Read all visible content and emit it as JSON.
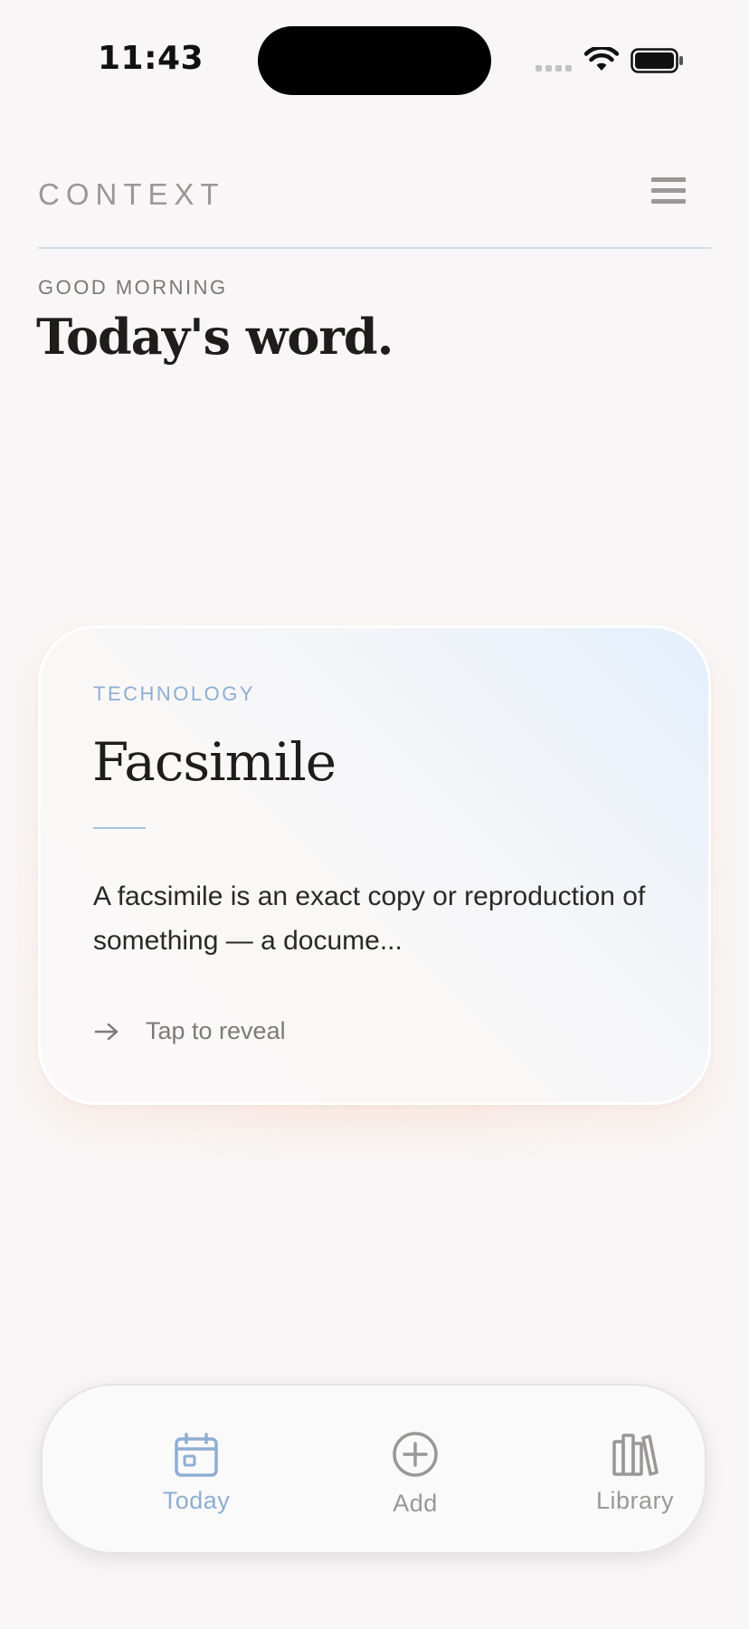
{
  "status_bar": {
    "time": "11:43"
  },
  "header": {
    "brand": "CONTEXT"
  },
  "greeting": "GOOD MORNING",
  "page_title": "Today's word.",
  "card": {
    "category": "TECHNOLOGY",
    "word": "Facsimile",
    "definition": "A facsimile is an exact copy or reproduction of something — a docume...",
    "reveal_label": "Tap to reveal"
  },
  "tab_bar": {
    "items": [
      {
        "label": "Today",
        "icon": "calendar-icon",
        "active": true
      },
      {
        "label": "Add",
        "icon": "plus-circle-icon",
        "active": false
      },
      {
        "label": "Library",
        "icon": "books-icon",
        "active": false
      }
    ]
  },
  "colors": {
    "accent": "#8eaed3",
    "background": "#f8f6f6",
    "inactive": "#9a9796"
  }
}
